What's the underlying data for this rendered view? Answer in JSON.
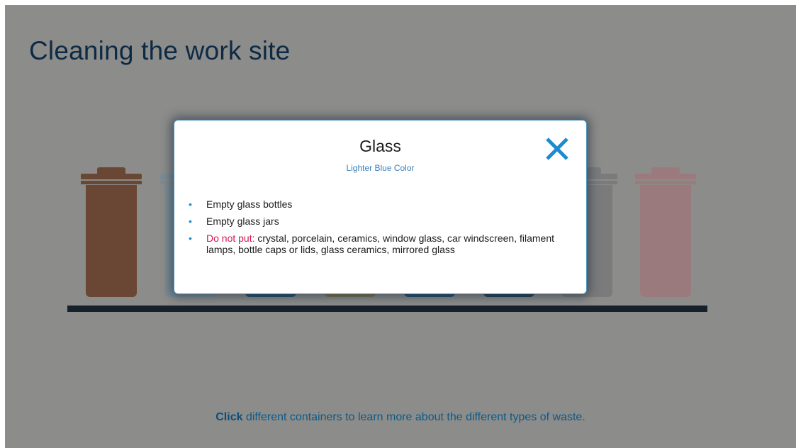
{
  "slide": {
    "title": "Cleaning the work site",
    "hint_bold": "Click",
    "hint_rest": " different containers to learn more about the different types of waste."
  },
  "bins": [
    {
      "name": "brown",
      "color": "#6a4634"
    },
    {
      "name": "light-blue",
      "color": "#7a8c96"
    },
    {
      "name": "blue",
      "color": "#1f4a66"
    },
    {
      "name": "yellow",
      "color": "#7a7048"
    },
    {
      "name": "blue-2",
      "color": "#1f4a66"
    },
    {
      "name": "dark-blue",
      "color": "#1c3a52"
    },
    {
      "name": "grey",
      "color": "#7b7b7b"
    },
    {
      "name": "pink",
      "color": "#9b7a7e"
    }
  ],
  "modal": {
    "title": "Glass",
    "subtitle": "Lighter Blue Color",
    "close_icon": "close-icon",
    "items": [
      {
        "text": "Empty glass bottles"
      },
      {
        "text": "Empty glass jars"
      },
      {
        "warn_label": "Do not put:",
        "text": " crystal, porcelain, ceramics, window glass, car windscreen, filament lamps, bottle caps or lids, glass ceramics, mirrored glass"
      }
    ]
  },
  "colors": {
    "overlay": "#8c8c8a",
    "title": "#0d2a45",
    "accent": "#1c8bd0",
    "warning": "#d8154e"
  }
}
